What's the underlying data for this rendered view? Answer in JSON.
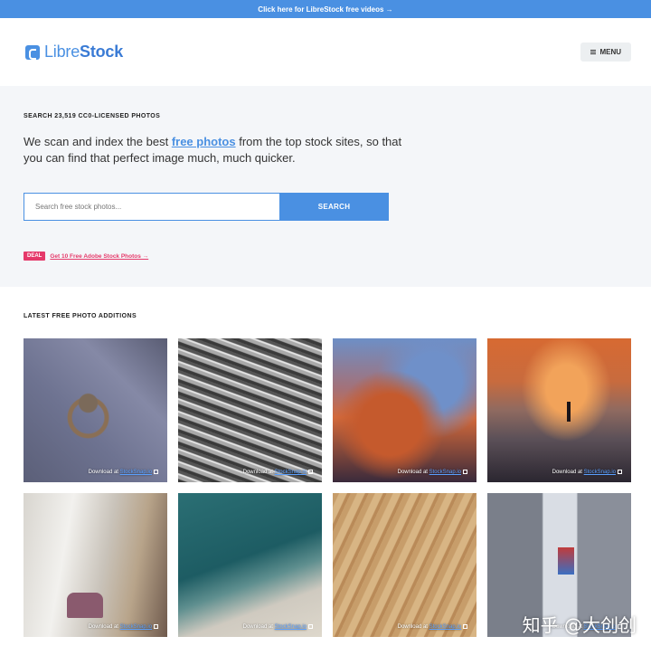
{
  "topbar": {
    "text": "Click here for LibreStock free videos →"
  },
  "header": {
    "logo_libre": "Libre",
    "logo_stock": "Stock",
    "menu_label": "MENU",
    "logo_icon": "librestock-logo-icon",
    "menu_icon": "hamburger-icon"
  },
  "hero": {
    "count_text": "SEARCH 23,519 CC0-LICENSED PHOTOS",
    "text_before": "We scan and index the best ",
    "text_link": "free photos",
    "text_after": " from the top stock sites, so that you can find that perfect image much, much quicker.",
    "search_placeholder": "Search free stock photos...",
    "search_button": "SEARCH",
    "deal_badge": "DEAL",
    "deal_link": "Get 10 Free Adobe Stock Photos →"
  },
  "latest": {
    "title": "LATEST FREE PHOTO ADDITIONS",
    "download_prefix": "Download at ",
    "source": "StockSnap.io",
    "photos": [
      "door-knocker",
      "nails",
      "sunset-clouds",
      "foggy-sunset",
      "yoga",
      "ocean-shore",
      "wood-grain",
      "barn-door"
    ]
  },
  "watermark": "知乎 @大创创",
  "colors": {
    "accent": "#4a90e2",
    "deal": "#e5396a",
    "hero_bg": "#f4f6f9"
  }
}
